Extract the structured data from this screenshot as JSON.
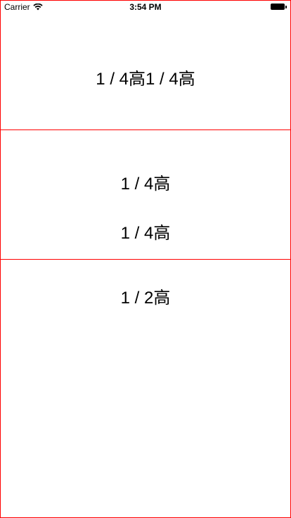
{
  "status_bar": {
    "carrier": "Carrier",
    "time": "3:54 PM",
    "wifi_icon": "wifi-icon",
    "battery_icon": "battery-icon"
  },
  "sections": {
    "top": {
      "text": "1 / 4高1 / 4高"
    },
    "middle": {
      "line1": "1 / 4高",
      "line2": "1 / 4高"
    },
    "bottom": {
      "text": "1 / 2高"
    }
  },
  "colors": {
    "border": "#ff0000",
    "background": "#ffffff",
    "text": "#000000"
  }
}
